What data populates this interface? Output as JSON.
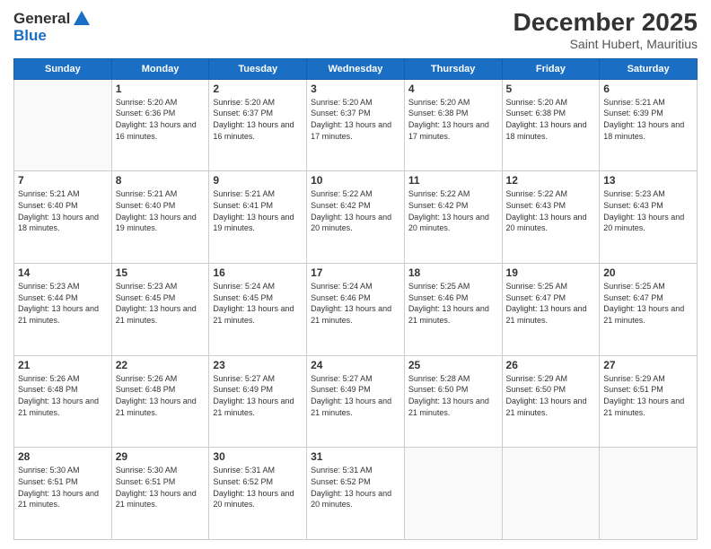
{
  "header": {
    "logo_general": "General",
    "logo_blue": "Blue",
    "main_title": "December 2025",
    "subtitle": "Saint Hubert, Mauritius"
  },
  "calendar": {
    "days_of_week": [
      "Sunday",
      "Monday",
      "Tuesday",
      "Wednesday",
      "Thursday",
      "Friday",
      "Saturday"
    ],
    "weeks": [
      [
        {
          "day": "",
          "sunrise": "",
          "sunset": "",
          "daylight": ""
        },
        {
          "day": "1",
          "sunrise": "5:20 AM",
          "sunset": "6:36 PM",
          "daylight": "13 hours and 16 minutes."
        },
        {
          "day": "2",
          "sunrise": "5:20 AM",
          "sunset": "6:37 PM",
          "daylight": "13 hours and 16 minutes."
        },
        {
          "day": "3",
          "sunrise": "5:20 AM",
          "sunset": "6:37 PM",
          "daylight": "13 hours and 17 minutes."
        },
        {
          "day": "4",
          "sunrise": "5:20 AM",
          "sunset": "6:38 PM",
          "daylight": "13 hours and 17 minutes."
        },
        {
          "day": "5",
          "sunrise": "5:20 AM",
          "sunset": "6:38 PM",
          "daylight": "13 hours and 18 minutes."
        },
        {
          "day": "6",
          "sunrise": "5:21 AM",
          "sunset": "6:39 PM",
          "daylight": "13 hours and 18 minutes."
        }
      ],
      [
        {
          "day": "7",
          "sunrise": "5:21 AM",
          "sunset": "6:40 PM",
          "daylight": "13 hours and 18 minutes."
        },
        {
          "day": "8",
          "sunrise": "5:21 AM",
          "sunset": "6:40 PM",
          "daylight": "13 hours and 19 minutes."
        },
        {
          "day": "9",
          "sunrise": "5:21 AM",
          "sunset": "6:41 PM",
          "daylight": "13 hours and 19 minutes."
        },
        {
          "day": "10",
          "sunrise": "5:22 AM",
          "sunset": "6:42 PM",
          "daylight": "13 hours and 20 minutes."
        },
        {
          "day": "11",
          "sunrise": "5:22 AM",
          "sunset": "6:42 PM",
          "daylight": "13 hours and 20 minutes."
        },
        {
          "day": "12",
          "sunrise": "5:22 AM",
          "sunset": "6:43 PM",
          "daylight": "13 hours and 20 minutes."
        },
        {
          "day": "13",
          "sunrise": "5:23 AM",
          "sunset": "6:43 PM",
          "daylight": "13 hours and 20 minutes."
        }
      ],
      [
        {
          "day": "14",
          "sunrise": "5:23 AM",
          "sunset": "6:44 PM",
          "daylight": "13 hours and 21 minutes."
        },
        {
          "day": "15",
          "sunrise": "5:23 AM",
          "sunset": "6:45 PM",
          "daylight": "13 hours and 21 minutes."
        },
        {
          "day": "16",
          "sunrise": "5:24 AM",
          "sunset": "6:45 PM",
          "daylight": "13 hours and 21 minutes."
        },
        {
          "day": "17",
          "sunrise": "5:24 AM",
          "sunset": "6:46 PM",
          "daylight": "13 hours and 21 minutes."
        },
        {
          "day": "18",
          "sunrise": "5:25 AM",
          "sunset": "6:46 PM",
          "daylight": "13 hours and 21 minutes."
        },
        {
          "day": "19",
          "sunrise": "5:25 AM",
          "sunset": "6:47 PM",
          "daylight": "13 hours and 21 minutes."
        },
        {
          "day": "20",
          "sunrise": "5:25 AM",
          "sunset": "6:47 PM",
          "daylight": "13 hours and 21 minutes."
        }
      ],
      [
        {
          "day": "21",
          "sunrise": "5:26 AM",
          "sunset": "6:48 PM",
          "daylight": "13 hours and 21 minutes."
        },
        {
          "day": "22",
          "sunrise": "5:26 AM",
          "sunset": "6:48 PM",
          "daylight": "13 hours and 21 minutes."
        },
        {
          "day": "23",
          "sunrise": "5:27 AM",
          "sunset": "6:49 PM",
          "daylight": "13 hours and 21 minutes."
        },
        {
          "day": "24",
          "sunrise": "5:27 AM",
          "sunset": "6:49 PM",
          "daylight": "13 hours and 21 minutes."
        },
        {
          "day": "25",
          "sunrise": "5:28 AM",
          "sunset": "6:50 PM",
          "daylight": "13 hours and 21 minutes."
        },
        {
          "day": "26",
          "sunrise": "5:29 AM",
          "sunset": "6:50 PM",
          "daylight": "13 hours and 21 minutes."
        },
        {
          "day": "27",
          "sunrise": "5:29 AM",
          "sunset": "6:51 PM",
          "daylight": "13 hours and 21 minutes."
        }
      ],
      [
        {
          "day": "28",
          "sunrise": "5:30 AM",
          "sunset": "6:51 PM",
          "daylight": "13 hours and 21 minutes."
        },
        {
          "day": "29",
          "sunrise": "5:30 AM",
          "sunset": "6:51 PM",
          "daylight": "13 hours and 21 minutes."
        },
        {
          "day": "30",
          "sunrise": "5:31 AM",
          "sunset": "6:52 PM",
          "daylight": "13 hours and 20 minutes."
        },
        {
          "day": "31",
          "sunrise": "5:31 AM",
          "sunset": "6:52 PM",
          "daylight": "13 hours and 20 minutes."
        },
        {
          "day": "",
          "sunrise": "",
          "sunset": "",
          "daylight": ""
        },
        {
          "day": "",
          "sunrise": "",
          "sunset": "",
          "daylight": ""
        },
        {
          "day": "",
          "sunrise": "",
          "sunset": "",
          "daylight": ""
        }
      ]
    ]
  }
}
